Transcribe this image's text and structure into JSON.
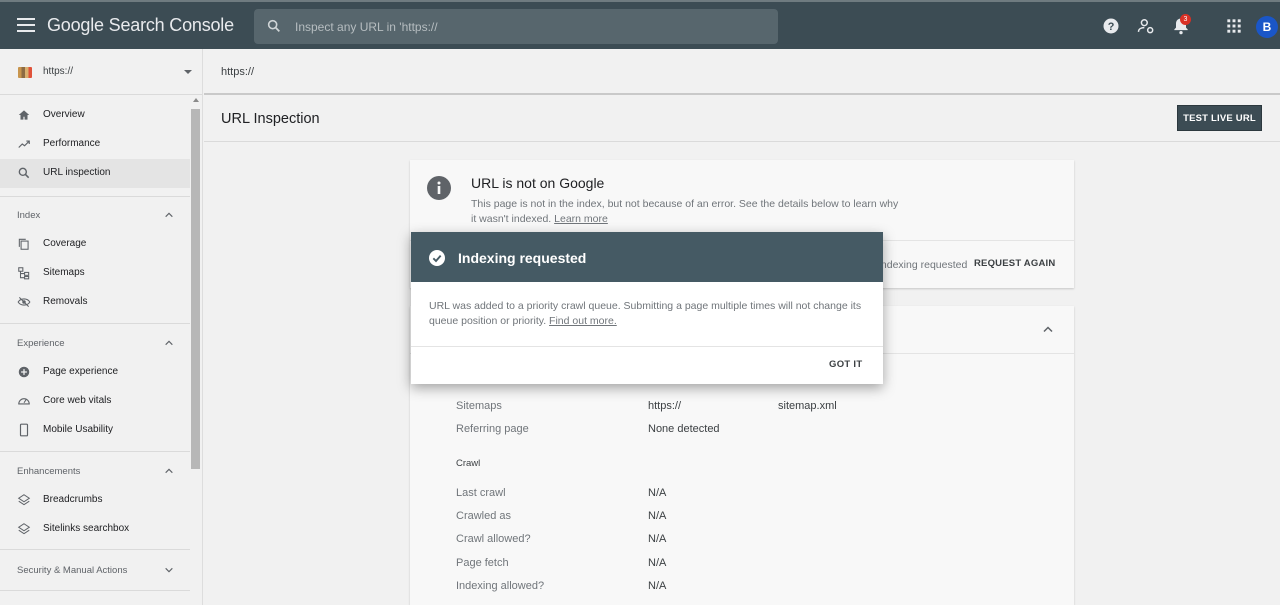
{
  "app": {
    "title": "Google Search Console"
  },
  "search": {
    "placeholder": "Inspect any URL in 'https://"
  },
  "header": {
    "notification_count": "3",
    "avatar_initial": "B"
  },
  "property": {
    "label": "https://"
  },
  "sidebar": {
    "items": [
      {
        "label": "Overview",
        "icon": "home-icon"
      },
      {
        "label": "Performance",
        "icon": "trending-icon"
      },
      {
        "label": "URL inspection",
        "icon": "search-icon"
      }
    ],
    "sections": [
      {
        "label": "Index",
        "items": [
          {
            "label": "Coverage",
            "icon": "coverage-icon"
          },
          {
            "label": "Sitemaps",
            "icon": "sitemap-icon"
          },
          {
            "label": "Removals",
            "icon": "removals-icon"
          }
        ]
      },
      {
        "label": "Experience",
        "items": [
          {
            "label": "Page experience",
            "icon": "page-experience-icon"
          },
          {
            "label": "Core web vitals",
            "icon": "gauge-icon"
          },
          {
            "label": "Mobile Usability",
            "icon": "mobile-icon"
          }
        ]
      },
      {
        "label": "Enhancements",
        "items": [
          {
            "label": "Breadcrumbs",
            "icon": "layers-icon"
          },
          {
            "label": "Sitelinks searchbox",
            "icon": "layers-icon"
          }
        ]
      },
      {
        "label": "Security & Manual Actions"
      }
    ]
  },
  "main": {
    "url": "https://",
    "page_title": "URL Inspection",
    "test_button": "TEST LIVE URL",
    "status_card": {
      "title": "URL is not on Google",
      "description": "This page is not in the index, but not because of an error. See the details below to learn why it wasn't indexed.",
      "learn_more": "Learn more",
      "status": "Indexing requested",
      "request_again": "REQUEST AGAIN"
    },
    "details": {
      "rows": [
        {
          "label": "Sitemaps",
          "value": "https://",
          "value2": "sitemap.xml"
        },
        {
          "label": "Referring page",
          "value": "None detected"
        }
      ],
      "crawl_heading": "Crawl",
      "crawl_rows": [
        {
          "label": "Last crawl",
          "value": "N/A"
        },
        {
          "label": "Crawled as",
          "value": "N/A"
        },
        {
          "label": "Crawl allowed?",
          "value": "N/A"
        },
        {
          "label": "Page fetch",
          "value": "N/A"
        },
        {
          "label": "Indexing allowed?",
          "value": "N/A"
        }
      ]
    }
  },
  "dialog": {
    "title": "Indexing requested",
    "body": "URL was added to a priority crawl queue. Submitting a page multiple times will not change its queue position or priority.",
    "find_out_more": "Find out more.",
    "button": "GOT IT"
  },
  "colors": {
    "topbar": "#3c4c54",
    "dialog_header": "#455a64",
    "badge": "#d93025",
    "avatar": "#1a56c8"
  }
}
